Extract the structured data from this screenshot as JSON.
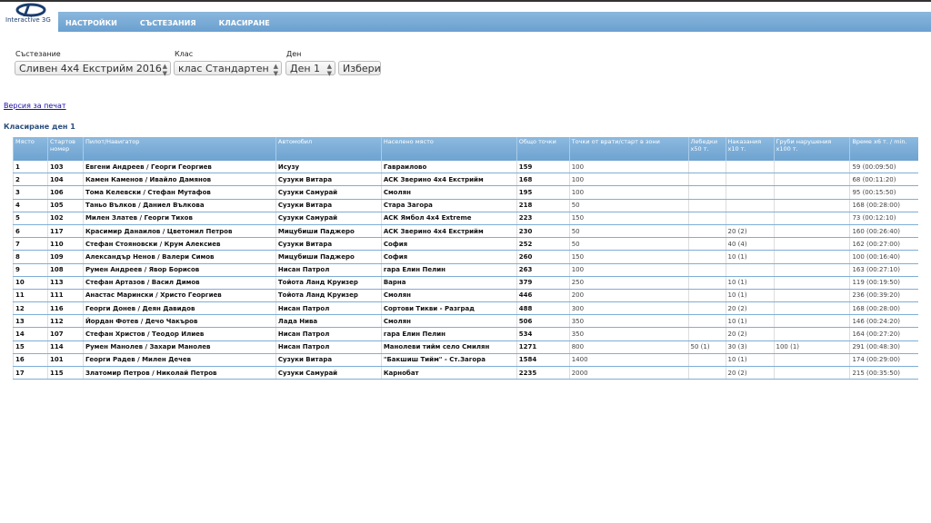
{
  "logo": {
    "text": "Interactive 3G"
  },
  "nav": [
    "НАСТРОЙКИ",
    "СЪСТЕЗАНИЯ",
    "КЛАСИРАНЕ"
  ],
  "filters": {
    "competition": {
      "label": "Състезание",
      "value": "Сливен 4x4 Екстрийм 2016"
    },
    "class": {
      "label": "Клас",
      "value": "клас Стандартен"
    },
    "day": {
      "label": "Ден",
      "value": "Ден 1"
    },
    "submit": "Избери"
  },
  "print_link": "Версия за печат",
  "title": "Класиране ден 1",
  "columns": [
    "Място",
    "Стартов номер",
    "Пилот/Навигатор",
    "Автомобил",
    "Населено място",
    "Общо точки",
    "Точки от врати/старт в зони",
    "Лебедки x50 т.",
    "Наказания x10 т.",
    "Груби нарушения x100 т.",
    "Време x6 т. / min."
  ],
  "rows": [
    [
      "1",
      "103",
      "Евгени Андреев / Георги Георгиев",
      "Исузу",
      "Гавраилово",
      "159",
      "100",
      "",
      "",
      "",
      "59 (00:09:50)"
    ],
    [
      "2",
      "104",
      "Камен Каменов / Ивайло Дамянов",
      "Сузуки Витара",
      "АСК Зверино 4x4 Екстрийм",
      "168",
      "100",
      "",
      "",
      "",
      "68 (00:11:20)"
    ],
    [
      "3",
      "106",
      "Тома Келевски / Стефан Мутафов",
      "Сузуки Самурай",
      "Смолян",
      "195",
      "100",
      "",
      "",
      "",
      "95 (00:15:50)"
    ],
    [
      "4",
      "105",
      "Таньо Вълков / Даниел Вълкова",
      "Сузуки Витара",
      "Стара Загора",
      "218",
      "50",
      "",
      "",
      "",
      "168 (00:28:00)"
    ],
    [
      "5",
      "102",
      "Милен Златев / Георги Тихов",
      "Сузуки Самурай",
      "АСК Ямбол 4x4 Extreme",
      "223",
      "150",
      "",
      "",
      "",
      "73 (00:12:10)"
    ],
    [
      "6",
      "117",
      "Красимир Данаилов / Цветомил Петров",
      "Мицубиши Паджеро",
      "АСК Зверино 4x4 Екстрийм",
      "230",
      "50",
      "",
      "20 (2)",
      "",
      "160 (00:26:40)"
    ],
    [
      "7",
      "110",
      "Стефан Стояновски / Крум Алексиев",
      "Сузуки Витара",
      "София",
      "252",
      "50",
      "",
      "40 (4)",
      "",
      "162 (00:27:00)"
    ],
    [
      "8",
      "109",
      "Александър Ненов / Валери Симов",
      "Мицубиши Паджеро",
      "София",
      "260",
      "150",
      "",
      "10 (1)",
      "",
      "100 (00:16:40)"
    ],
    [
      "9",
      "108",
      "Румен Андреев / Явор Борисов",
      "Нисан Патрол",
      "гара Елин Пелин",
      "263",
      "100",
      "",
      "",
      "",
      "163 (00:27:10)"
    ],
    [
      "10",
      "113",
      "Стефан Артазов / Васил Димов",
      "Тойота Ланд Круизер",
      "Варна",
      "379",
      "250",
      "",
      "10 (1)",
      "",
      "119 (00:19:50)"
    ],
    [
      "11",
      "111",
      "Анастас Марински / Христо Георгиев",
      "Тойота Ланд Круизер",
      "Смолян",
      "446",
      "200",
      "",
      "10 (1)",
      "",
      "236 (00:39:20)"
    ],
    [
      "12",
      "116",
      "Георги Донев / Деян Давидов",
      "Нисан Патрол",
      "Сортови Тикви - Разград",
      "488",
      "300",
      "",
      "20 (2)",
      "",
      "168 (00:28:00)"
    ],
    [
      "13",
      "112",
      "Йордан Фотев / Дечо Чакъров",
      "Лада Нива",
      "Смолян",
      "506",
      "350",
      "",
      "10 (1)",
      "",
      "146 (00:24:20)"
    ],
    [
      "14",
      "107",
      "Стефан Христов / Теодор Илиев",
      "Нисан Патрол",
      "гара Елин Пелин",
      "534",
      "350",
      "",
      "20 (2)",
      "",
      "164 (00:27:20)"
    ],
    [
      "15",
      "114",
      "Румен Манолев / Захари Манолев",
      "Нисан Патрол",
      "Манолеви тийм село Смилян",
      "1271",
      "800",
      "50 (1)",
      "30 (3)",
      "100 (1)",
      "291 (00:48:30)"
    ],
    [
      "16",
      "101",
      "Георги Радев / Милен Дечев",
      "Сузуки Витара",
      "\"Бакшиш Тийм\" - Ст.Загора",
      "1584",
      "1400",
      "",
      "10 (1)",
      "",
      "174 (00:29:00)"
    ],
    [
      "17",
      "115",
      "Златомир Петров / Николай Петров",
      "Сузуки Самурай",
      "Карнобат",
      "2235",
      "2000",
      "",
      "20 (2)",
      "",
      "215 (00:35:50)"
    ]
  ]
}
